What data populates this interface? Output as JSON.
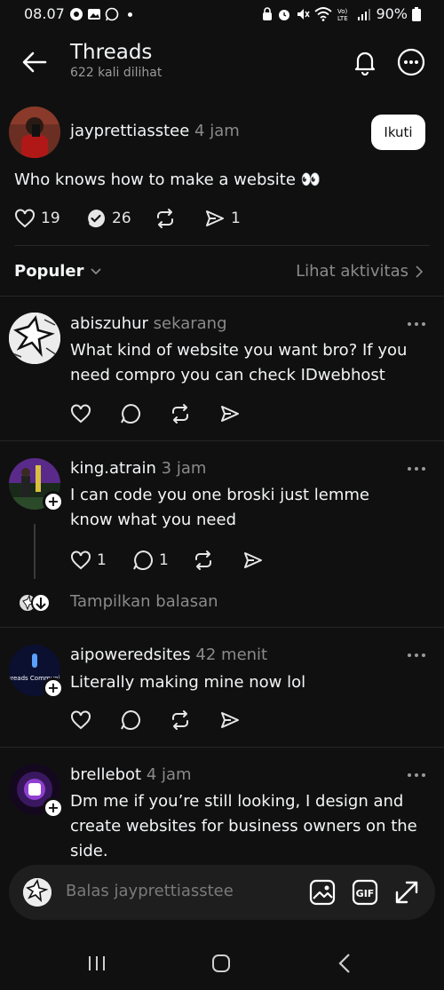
{
  "status_bar": {
    "time": "08.07",
    "battery": "90%"
  },
  "header": {
    "title": "Threads",
    "views": "622 kali dilihat"
  },
  "original_post": {
    "username": "jayprettiasstee",
    "time": "4 jam",
    "follow_label": "Ikuti",
    "text": "Who knows how to make a website 👀",
    "likes": "19",
    "replies": "26",
    "shares": "1"
  },
  "sort": {
    "label": "Populer",
    "activity_link": "Lihat aktivitas"
  },
  "replies": [
    {
      "username": "abiszuhur",
      "time": "sekarang",
      "text": "What kind of website you want bro? If you need compro you can check IDwebhost",
      "likes": "",
      "comments": ""
    },
    {
      "username": "king.atrain",
      "time": "3 jam",
      "text": "I can code you one broski just lemme know what you need",
      "likes": "1",
      "comments": "1",
      "show_replies": "Tampilkan balasan"
    },
    {
      "username": "aipoweredsites",
      "time": "42 menit",
      "text": "Literally making mine now lol",
      "likes": "",
      "comments": "",
      "avatar_text": "Threads Community"
    },
    {
      "username": "brellebot",
      "time": "4 jam",
      "text": "Dm me if you’re still looking, I design and create websites for business owners on the side."
    }
  ],
  "composer": {
    "placeholder": "Balas jayprettiasstee",
    "gif_label": "GIF"
  },
  "colors": {
    "background": "#101010",
    "text": "#f3f5f7",
    "muted": "#8a8a8a",
    "divider": "#262626"
  }
}
